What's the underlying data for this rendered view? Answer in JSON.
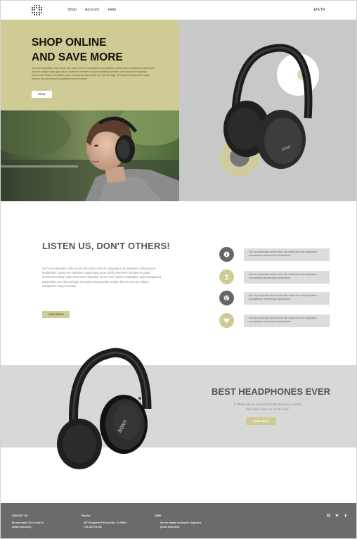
{
  "nav": {
    "links": [
      "Shop",
      "Account",
      "Help"
    ],
    "lang": "EN/TR"
  },
  "hero": {
    "title_line1": "SHOP ONLINE",
    "title_line2": "AND SAVE MORE",
    "text": "Sed ut perspiciatis unde omnis iste natus error sit voluptatem accusantium doloremque laudantium, totam rem aperiam, eaque ipsa quae ab illo inventore veritatis et quasi architecto beatae vitae dicta sunt explicabo. Nemo enim ipsam voluptatem quia voluptas sit aspernatur aut odit aut fugit, sed quia consequuntur magni dolores eos qui ratione voluptatem sequi nesciunt.",
    "button": "Shop"
  },
  "listen": {
    "title": "LISTEN US, DON'T OTHERS!",
    "text": "Sed ut perspiciatis unde omnis iste natus error sit voluptatem accusantium doloremque laudantium, totam rem aperiam, eaque ipsa quae ab illo inventore veritatis et quasi architecto beatae vitae dicta sunt explicabo. Nemo enim ipsam voluptatem quia voluptas sit aspernatur aut odit aut fugit, sed quia consequuntur magni dolores eos qui ratione voluptatem sequi nesciunt.",
    "button": "Hear News",
    "features": [
      {
        "icon": "info-icon",
        "text": "Sed ut perspiciatis unde omnis iste natus error sit voluptatem accusantium doloremque laudantium."
      },
      {
        "icon": "user-icon",
        "text": "Sed ut perspiciatis unde omnis iste natus error sit voluptatem accusantium doloremque laudantium."
      },
      {
        "icon": "globe-icon",
        "text": "Sed ut perspiciatis unde omnis iste natus error sit voluptatem accusantium doloremque laudantium."
      },
      {
        "icon": "heart-icon",
        "text": "Sed ut perspiciatis unde omnis iste natus error sit voluptatem accusantium doloremque laudantium."
      }
    ]
  },
  "best": {
    "title": "BEST HEADPHONES EVER",
    "text": "It allows you to see and feel by hearing. A sense has never been so much more.",
    "button": "Learn More"
  },
  "product": {
    "brand": "SONY"
  },
  "footer": {
    "contact_head": "CONTACT US",
    "contact_line1": "We are ready 7/24 to hear it!",
    "contact_line2": "[email protected]",
    "find_head": "Find Us",
    "find_line1": "467 Evergreen Rd.Roseville, CA 95673",
    "find_line2": "+44 345 678 903",
    "jobs_head": "JOBS",
    "jobs_line1": "We are always looking for engineers",
    "jobs_line2": "[email protected]",
    "social": [
      "instagram-icon",
      "twitter-icon",
      "facebook-icon"
    ]
  },
  "colors": {
    "accent": "#cfcb94",
    "hero_right_bg": "#c9c8c9",
    "best_bg": "#d8d8d8",
    "footer_bg": "#6b6b6b",
    "icon_dark": "#666666"
  }
}
